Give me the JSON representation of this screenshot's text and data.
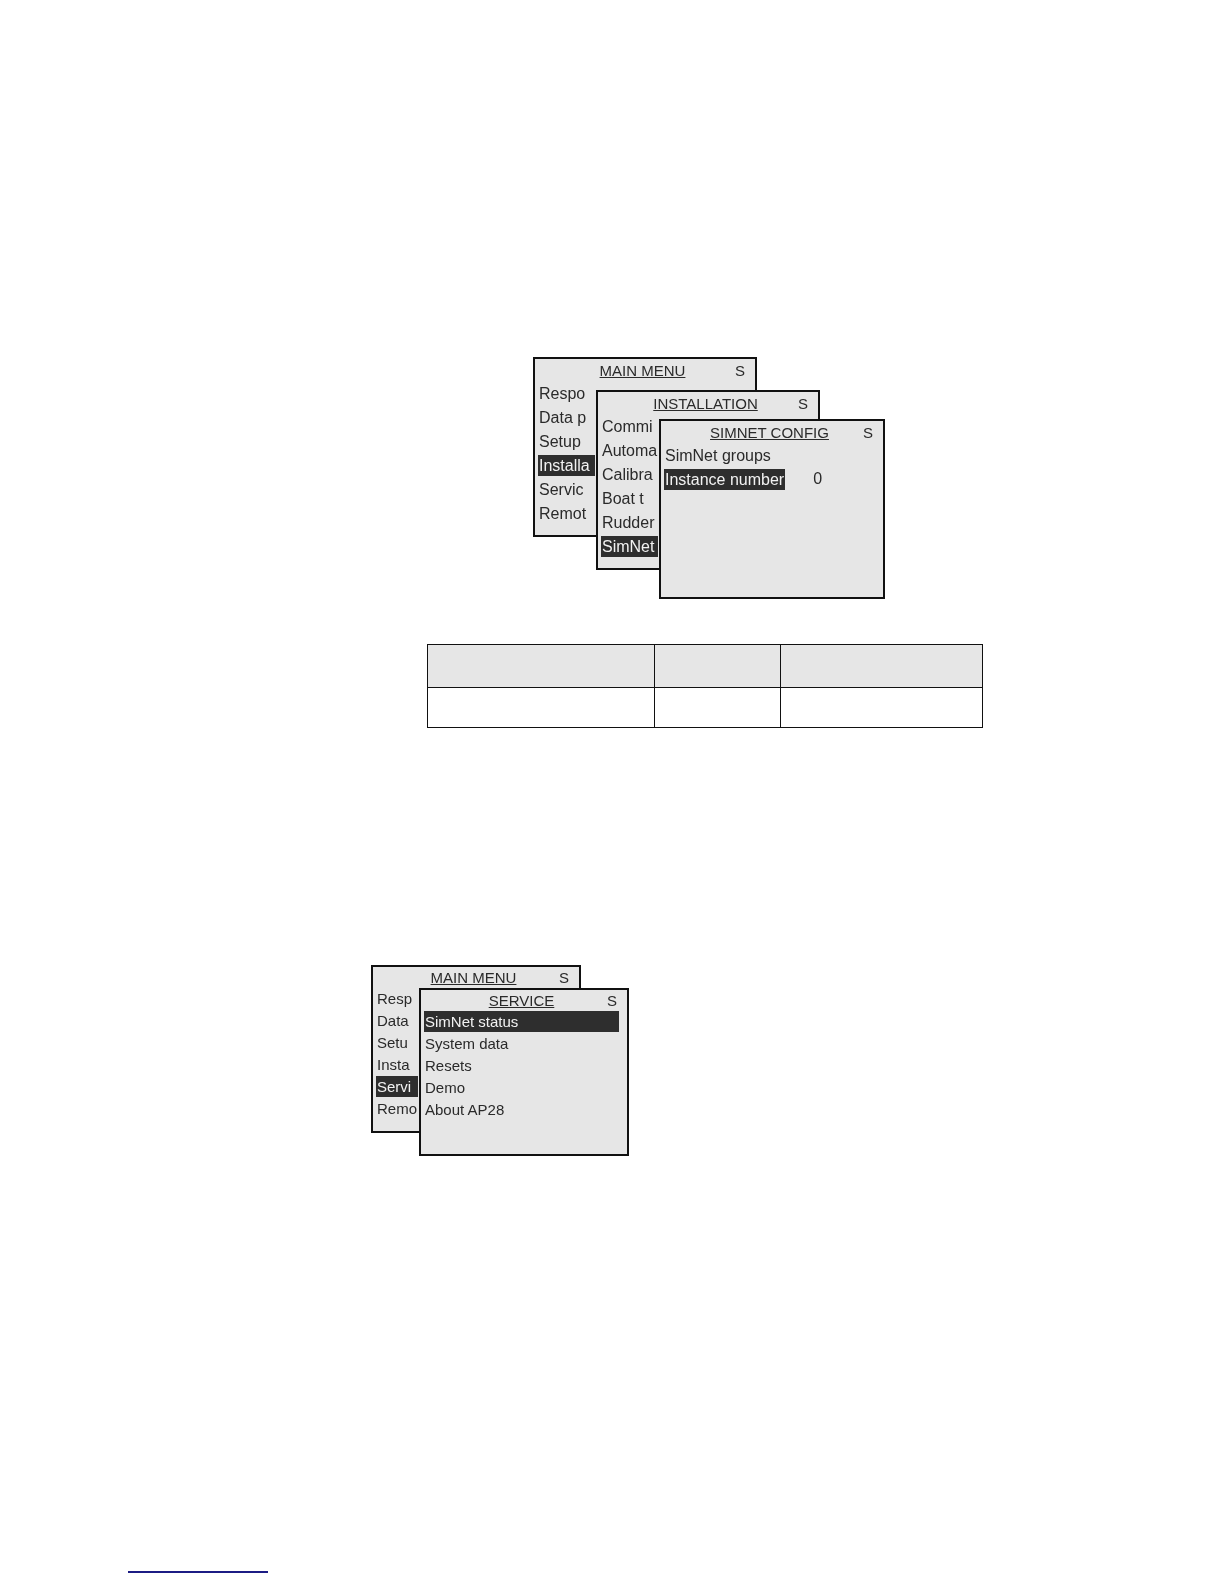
{
  "figures": [
    {
      "windows": [
        {
          "title": "MAIN MENU",
          "status": "S",
          "items": [
            {
              "label": "Respo",
              "selected": false
            },
            {
              "label": "Data p",
              "selected": false
            },
            {
              "label": "Setup",
              "selected": false
            },
            {
              "label": "Installa",
              "selected": true
            },
            {
              "label": "Servic",
              "selected": false
            },
            {
              "label": "Remot",
              "selected": false
            }
          ]
        },
        {
          "title": "INSTALLATION",
          "status": "S",
          "items": [
            {
              "label": "Commi",
              "selected": false
            },
            {
              "label": "Automa",
              "selected": false
            },
            {
              "label": "Calibra",
              "selected": false
            },
            {
              "label": "Boat t",
              "selected": false
            },
            {
              "label": "Rudder",
              "selected": false
            },
            {
              "label": "SimNet",
              "selected": true
            }
          ]
        },
        {
          "title": "SIMNET CONFIG",
          "status": "S",
          "items": [
            {
              "label": "SimNet groups",
              "selected": false
            },
            {
              "label": "Instance number",
              "selected": true,
              "value": "0"
            }
          ]
        }
      ]
    },
    {
      "windows": [
        {
          "title": "MAIN MENU",
          "status": "S",
          "items": [
            {
              "label": "Resp",
              "selected": false
            },
            {
              "label": "Data",
              "selected": false
            },
            {
              "label": "Setu",
              "selected": false
            },
            {
              "label": "Insta",
              "selected": false
            },
            {
              "label": "Servi",
              "selected": true
            },
            {
              "label": "Remo",
              "selected": false
            }
          ]
        },
        {
          "title": "SERVICE",
          "status": "S",
          "items": [
            {
              "label": "SimNet status",
              "selected": true
            },
            {
              "label": "System data",
              "selected": false
            },
            {
              "label": "Resets",
              "selected": false
            },
            {
              "label": "Demo",
              "selected": false
            },
            {
              "label": "About AP28",
              "selected": false
            }
          ]
        }
      ]
    }
  ]
}
